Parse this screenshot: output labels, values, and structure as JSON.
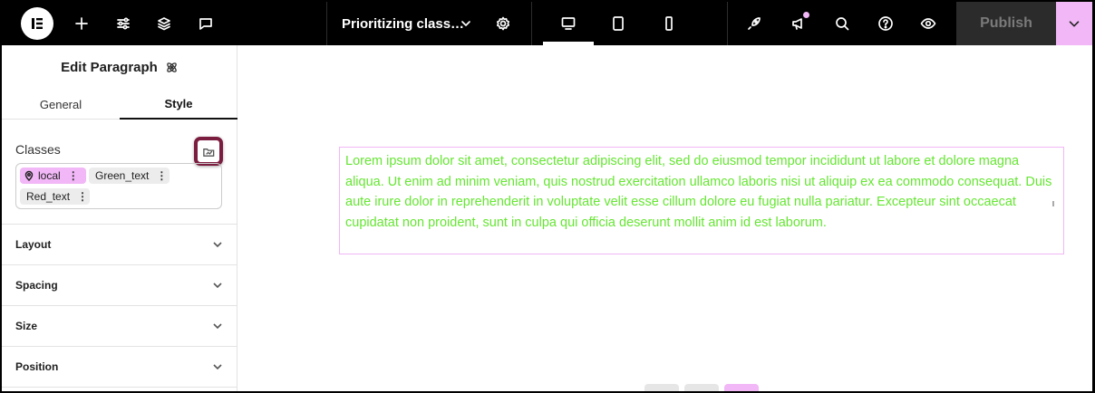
{
  "topbar": {
    "logo": "elementor-logo-icon",
    "icons_left": [
      "plus-icon",
      "sliders-icon",
      "layers-icon",
      "comment-icon"
    ],
    "page_title": "Prioritizing class…",
    "icons_devices": [
      "desktop-icon",
      "tablet-icon",
      "mobile-icon"
    ],
    "icons_right": [
      "rocket-icon",
      "megaphone-icon",
      "search-icon",
      "help-icon",
      "eye-icon"
    ],
    "publish_label": "Publish",
    "colors": {
      "bar": "#000000",
      "accent": "#f1b7f6",
      "publish_bg": "#2b2b2b"
    }
  },
  "panel": {
    "title": "Edit Paragraph",
    "tabs": [
      {
        "label": "General",
        "active": false
      },
      {
        "label": "Style",
        "active": true
      }
    ],
    "classes_label": "Classes",
    "chips": [
      {
        "label": "local",
        "icon": "location-pin-icon",
        "type": "local"
      },
      {
        "label": "Green_text",
        "type": "plain"
      },
      {
        "label": "Red_text",
        "type": "plain"
      }
    ],
    "sections": [
      "Layout",
      "Spacing",
      "Size",
      "Position"
    ]
  },
  "canvas": {
    "paragraph": "Lorem ipsum dolor sit amet, consectetur adipiscing elit, sed do eiusmod tempor incididunt ut labore et dolore magna aliqua. Ut enim ad minim veniam, quis nostrud exercitation ullamco laboris nisi ut aliquip ex ea commodo consequat. Duis aute irure dolor in reprehenderit in voluptate velit esse cillum dolore eu fugiat nulla pariatur. Excepteur sint occaecat cupidatat non proident, sunt in culpa qui officia deserunt mollit anim id est laborum.",
    "text_color": "#66e633",
    "outline_color": "#f1b7f6"
  }
}
